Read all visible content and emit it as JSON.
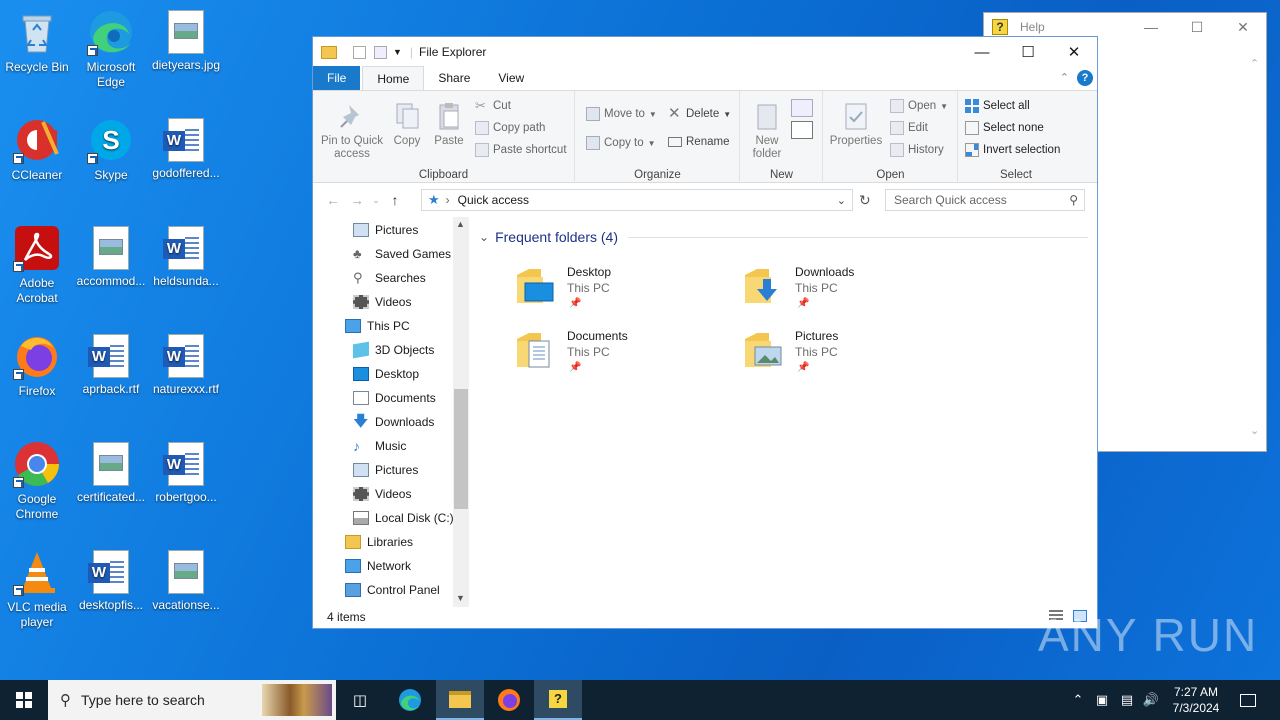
{
  "desktop": {
    "icons": [
      {
        "label": "Recycle Bin"
      },
      {
        "label": "Microsoft Edge"
      },
      {
        "label": "dietyears.jpg"
      },
      {
        "label": "CCleaner"
      },
      {
        "label": "Skype"
      },
      {
        "label": "godoffered..."
      },
      {
        "label": "Adobe Acrobat"
      },
      {
        "label": "accommod..."
      },
      {
        "label": "heldsunda..."
      },
      {
        "label": "Firefox"
      },
      {
        "label": "aprback.rtf"
      },
      {
        "label": "naturexxx.rtf"
      },
      {
        "label": "Google Chrome"
      },
      {
        "label": "certificated..."
      },
      {
        "label": "robertgoo..."
      },
      {
        "label": "VLC media player"
      },
      {
        "label": "desktopfis..."
      },
      {
        "label": "vacationse..."
      }
    ]
  },
  "help_window": {
    "title": "Help"
  },
  "explorer": {
    "title": "File Explorer",
    "tabs": [
      "File",
      "Home",
      "Share",
      "View"
    ],
    "ribbon": {
      "clipboard": {
        "label": "Clipboard",
        "pin": "Pin to Quick access",
        "copy": "Copy",
        "paste": "Paste",
        "cut": "Cut",
        "copy_path": "Copy path",
        "paste_shortcut": "Paste shortcut"
      },
      "organize": {
        "label": "Organize",
        "move_to": "Move to",
        "copy_to": "Copy to",
        "delete": "Delete",
        "rename": "Rename"
      },
      "new": {
        "label": "New",
        "new_folder": "New folder"
      },
      "open": {
        "label": "Open",
        "properties": "Properties",
        "open": "Open",
        "edit": "Edit",
        "history": "History"
      },
      "select": {
        "label": "Select",
        "select_all": "Select all",
        "select_none": "Select none",
        "invert": "Invert selection"
      }
    },
    "address": {
      "path": "Quick access",
      "search_placeholder": "Search Quick access"
    },
    "nav": [
      {
        "label": "Pictures"
      },
      {
        "label": "Saved Games"
      },
      {
        "label": "Searches"
      },
      {
        "label": "Videos"
      },
      {
        "label": "This PC"
      },
      {
        "label": "3D Objects"
      },
      {
        "label": "Desktop"
      },
      {
        "label": "Documents"
      },
      {
        "label": "Downloads"
      },
      {
        "label": "Music"
      },
      {
        "label": "Pictures"
      },
      {
        "label": "Videos"
      },
      {
        "label": "Local Disk (C:)"
      },
      {
        "label": "Libraries"
      },
      {
        "label": "Network"
      },
      {
        "label": "Control Panel"
      }
    ],
    "frequent_header": "Frequent folders (4)",
    "folders": [
      {
        "name": "Desktop",
        "location": "This PC"
      },
      {
        "name": "Downloads",
        "location": "This PC"
      },
      {
        "name": "Documents",
        "location": "This PC"
      },
      {
        "name": "Pictures",
        "location": "This PC"
      }
    ],
    "status": "4 items"
  },
  "taskbar": {
    "search_placeholder": "Type here to search",
    "time": "7:27 AM",
    "date": "7/3/2024"
  },
  "watermark": "ANY RUN"
}
